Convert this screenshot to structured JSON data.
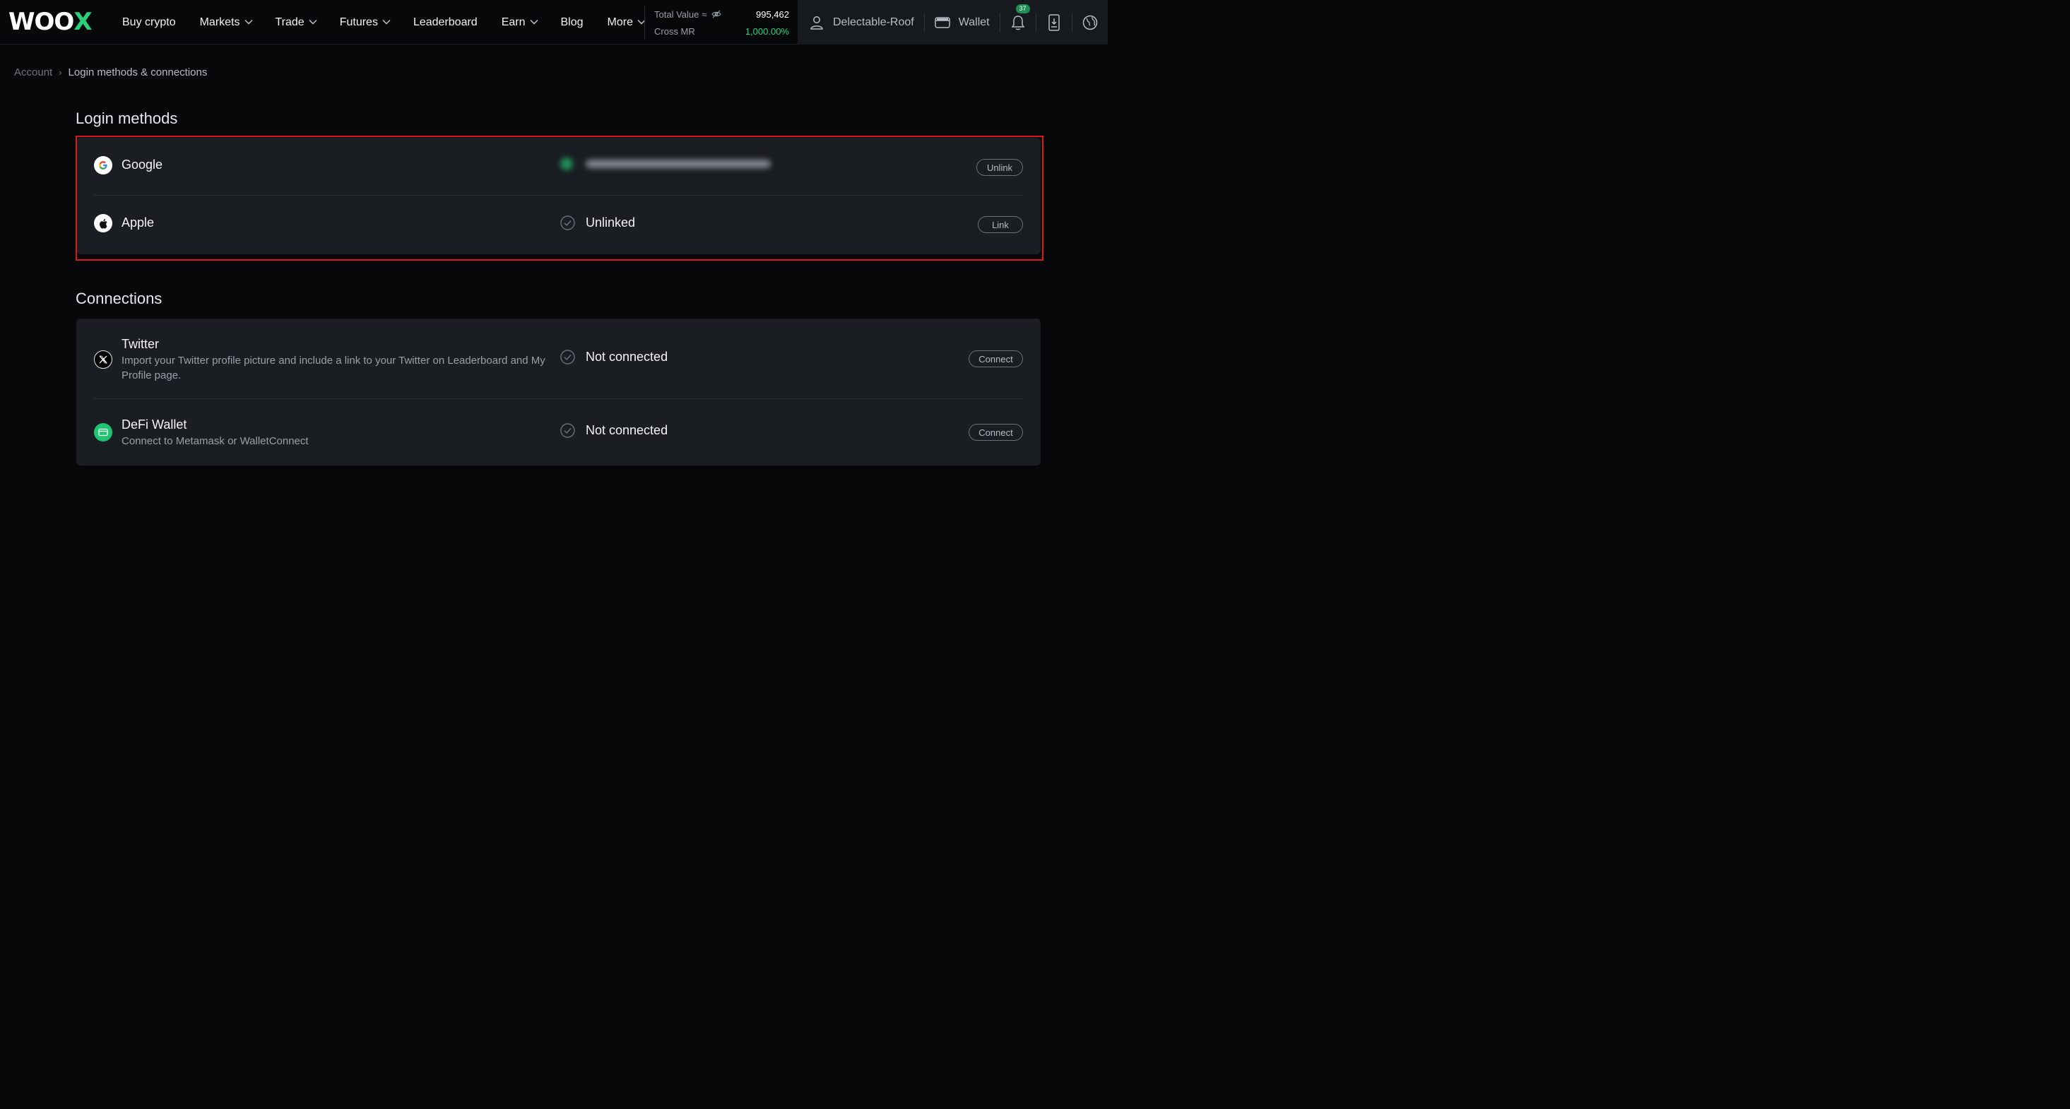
{
  "brand": {
    "logo_main": "WOO",
    "logo_accent": "X",
    "accent_color": "#28d07a"
  },
  "nav": {
    "items": [
      {
        "label": "Buy crypto",
        "dropdown": false
      },
      {
        "label": "Markets",
        "dropdown": true
      },
      {
        "label": "Trade",
        "dropdown": true
      },
      {
        "label": "Futures",
        "dropdown": true
      },
      {
        "label": "Leaderboard",
        "dropdown": false
      },
      {
        "label": "Earn",
        "dropdown": true
      },
      {
        "label": "Blog",
        "dropdown": false
      },
      {
        "label": "More",
        "dropdown": true
      }
    ]
  },
  "balance": {
    "total_label": "Total Value",
    "approx": "≈",
    "total_value": "995,462",
    "mr_label": "Cross MR",
    "mr_value": "1,000.00%"
  },
  "account": {
    "username": "Delectable-Roof",
    "wallet_label": "Wallet",
    "notification_count": "37"
  },
  "breadcrumb": {
    "parent": "Account",
    "current": "Login methods & connections"
  },
  "login_methods": {
    "title": "Login methods",
    "items": [
      {
        "name": "Google",
        "status": "",
        "action": "Unlink"
      },
      {
        "name": "Apple",
        "status": "Unlinked",
        "action": "Link"
      }
    ]
  },
  "connections": {
    "title": "Connections",
    "items": [
      {
        "name": "Twitter",
        "description": "Import your Twitter profile picture and include a link to your Twitter on Leaderboard and My Profile page.",
        "status": "Not connected",
        "action": "Connect"
      },
      {
        "name": "DeFi Wallet",
        "description": "Connect to Metamask or WalletConnect",
        "status": "Not connected",
        "action": "Connect"
      }
    ]
  },
  "colors": {
    "highlight": "#e0141a",
    "positive": "#2bd47f"
  }
}
